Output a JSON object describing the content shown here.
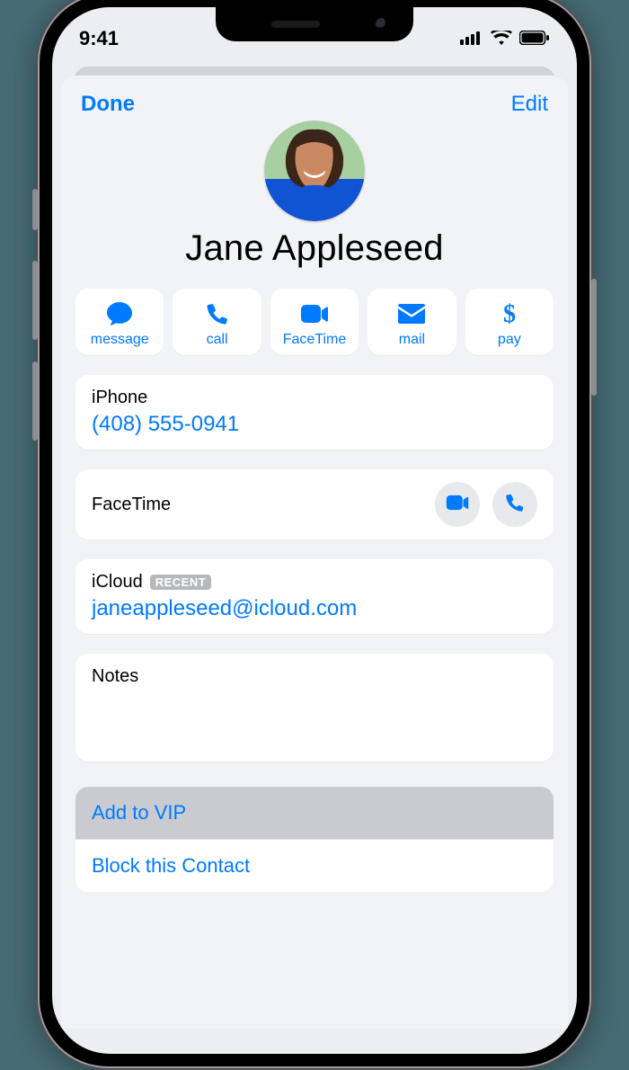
{
  "status": {
    "time": "9:41"
  },
  "navbar": {
    "done": "Done",
    "edit": "Edit"
  },
  "contact": {
    "name": "Jane Appleseed"
  },
  "actions": {
    "message": "message",
    "call": "call",
    "facetime": "FaceTime",
    "mail": "mail",
    "pay": "pay"
  },
  "phone": {
    "label": "iPhone",
    "number": "(408) 555-0941"
  },
  "facetime": {
    "label": "FaceTime"
  },
  "email": {
    "label": "iCloud",
    "badge": "RECENT",
    "address": "janeappleseed@icloud.com"
  },
  "notes": {
    "label": "Notes"
  },
  "menu": {
    "add_vip": "Add to VIP",
    "block": "Block this Contact"
  }
}
